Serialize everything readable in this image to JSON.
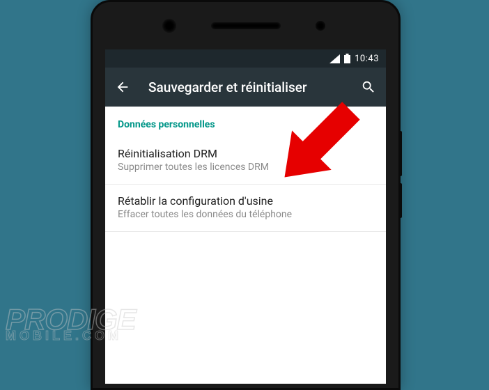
{
  "status_bar": {
    "time": "10:43"
  },
  "app_bar": {
    "title": "Sauvegarder et réinitialiser"
  },
  "section": {
    "header": "Données personnelles",
    "items": [
      {
        "title": "Réinitialisation DRM",
        "subtitle": "Supprimer toutes les licences DRM"
      },
      {
        "title": "Rétablir la configuration d'usine",
        "subtitle": "Effacer toutes les données du téléphone"
      }
    ]
  },
  "watermark": {
    "line1": "PRODIGE",
    "line2": "MOBILE.COM"
  }
}
